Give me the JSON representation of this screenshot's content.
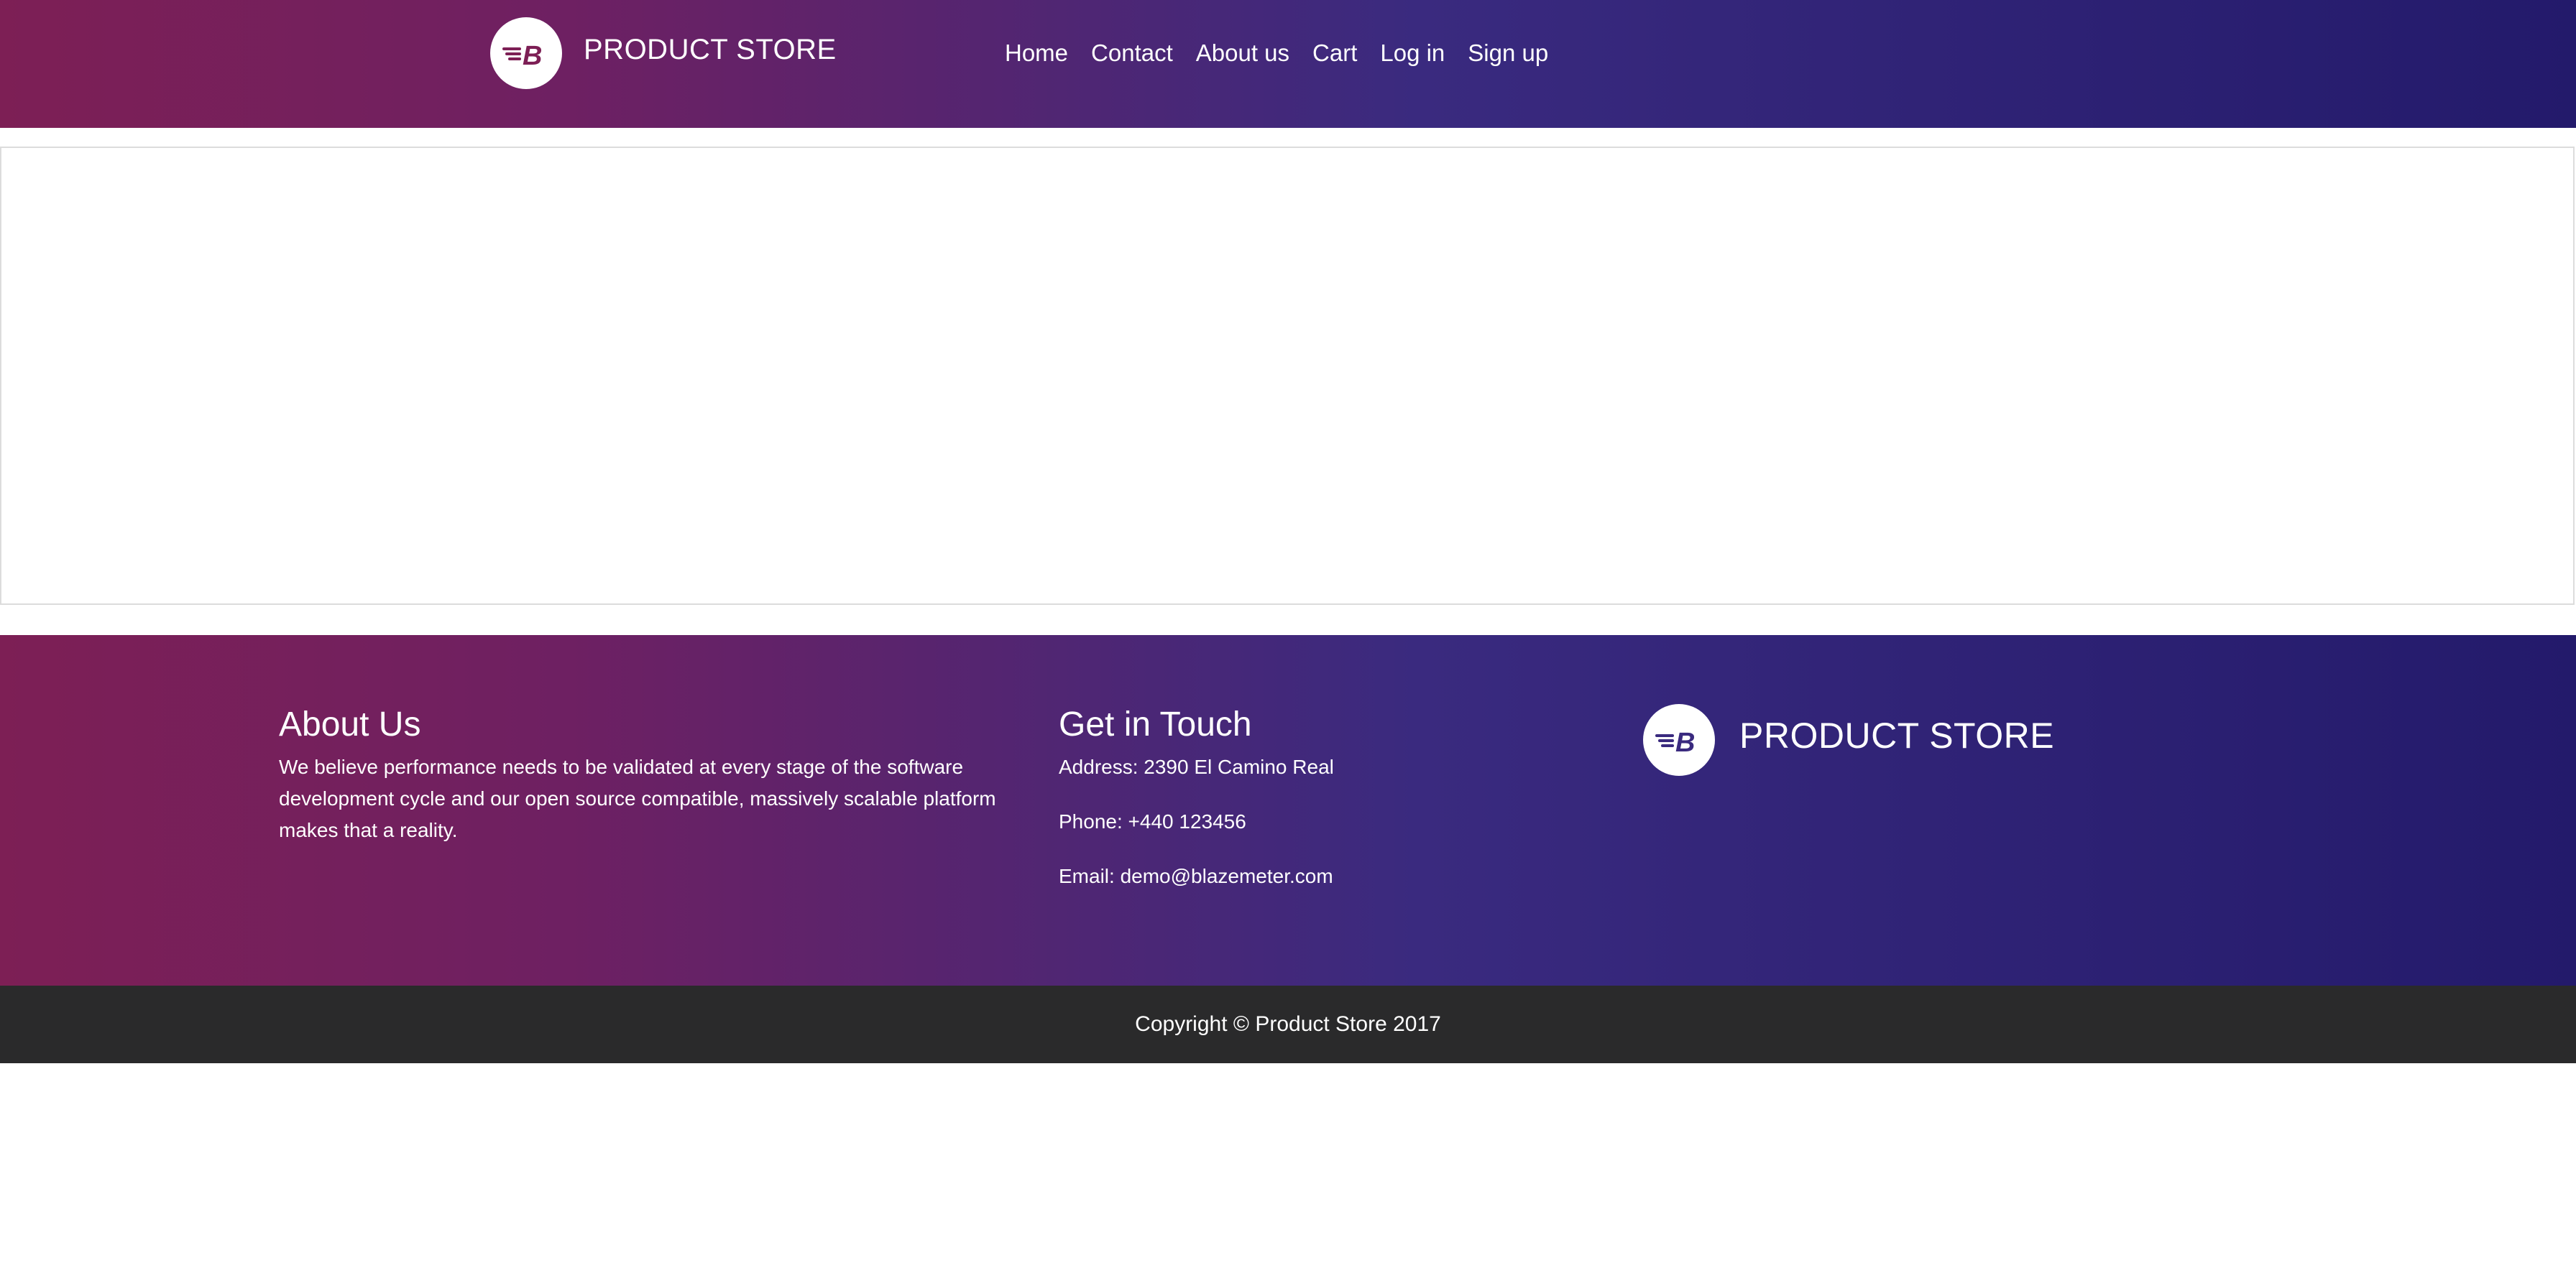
{
  "navbar": {
    "brand": "PRODUCT STORE",
    "logo_icon": "blazemeter-logo-icon",
    "links": [
      "Home",
      "Contact",
      "About us",
      "Cart",
      "Log in",
      "Sign up"
    ]
  },
  "footer": {
    "about": {
      "heading": "About Us",
      "text": "We believe performance needs to be validated at every stage of the software development cycle and our open source compatible, massively scalable platform makes that a reality."
    },
    "contact": {
      "heading": "Get in Touch",
      "address": "Address: 2390 El Camino Real",
      "phone": "Phone: +440 123456",
      "email": "Email: demo@blazemeter.com"
    },
    "brand": "PRODUCT STORE"
  },
  "copyright": "Copyright © Product Store 2017",
  "colors": {
    "gradient_start": "#7d1f55",
    "gradient_end": "#231a6b",
    "copyright_bg": "#2a2a2b"
  }
}
